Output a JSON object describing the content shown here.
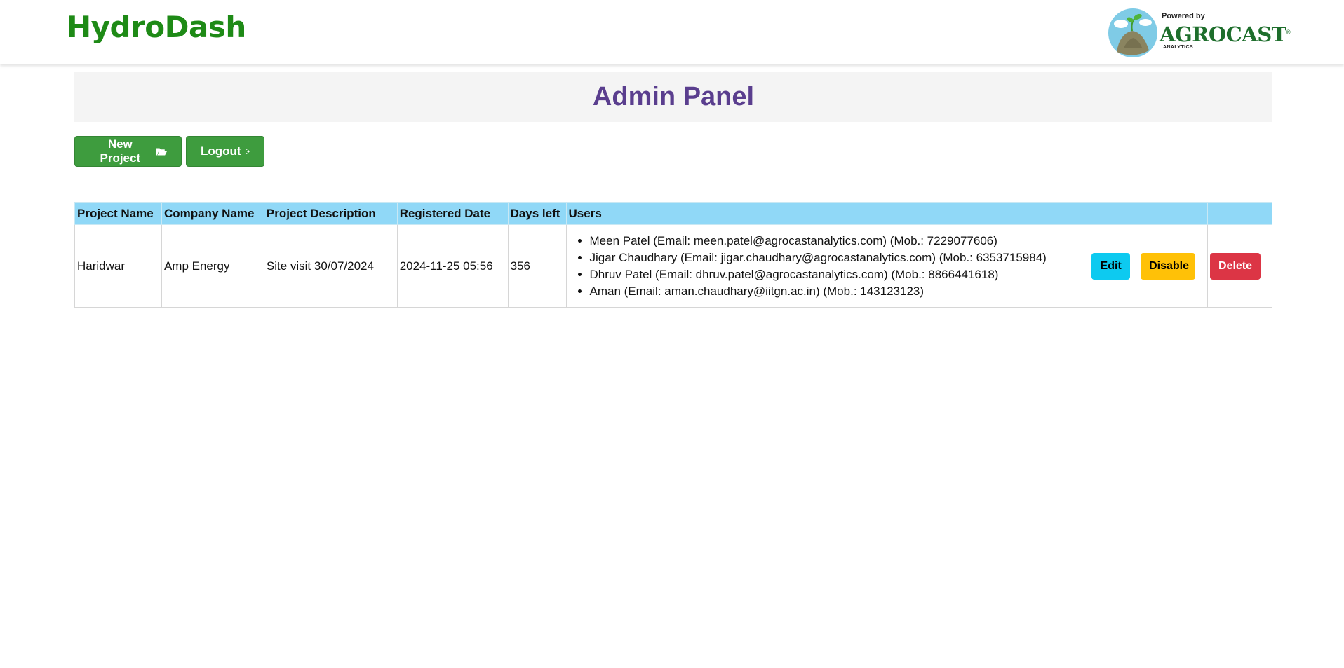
{
  "header": {
    "brand": "HydroDash",
    "logo": {
      "powered_by": "Powered by",
      "name": "AGROCAST",
      "sub": "ANALYTICS",
      "registered": "®"
    }
  },
  "panel": {
    "title": "Admin Panel"
  },
  "actions": {
    "new_project": "New Project",
    "new_project_icon": "folder-open-icon",
    "logout": "Logout",
    "logout_icon": "sign-out-icon"
  },
  "table": {
    "headers": [
      "Project Name",
      "Company Name",
      "Project Description",
      "Registered Date",
      "Days left",
      "Users",
      "",
      "",
      ""
    ],
    "rows": [
      {
        "project_name": "Haridwar",
        "company_name": "Amp Energy",
        "description": "Site visit 30/07/2024",
        "registered_date": "2024-11-25 05:56",
        "days_left": "356",
        "users": [
          "Meen Patel (Email: meen.patel@agrocastanalytics.com) (Mob.: 7229077606)",
          "Jigar Chaudhary (Email: jigar.chaudhary@agrocastanalytics.com) (Mob.: 6353715984)",
          "Dhruv Patel (Email: dhruv.patel@agrocastanalytics.com) (Mob.: 8866441618)",
          "Aman (Email: aman.chaudhary@iitgn.ac.in) (Mob.: 143123123)"
        ],
        "edit": "Edit",
        "disable": "Disable",
        "delete": "Delete"
      }
    ]
  },
  "colors": {
    "brand": "#1e8a16",
    "title": "#5a3e8e",
    "table_header": "#90d8f7",
    "green_button": "#3e9c3e",
    "edit": "#0dcaf0",
    "disable": "#ffc107",
    "delete": "#dc3545"
  }
}
